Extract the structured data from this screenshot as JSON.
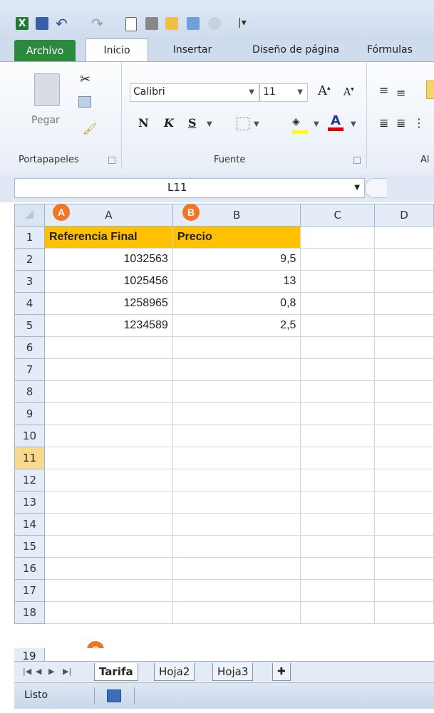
{
  "colors": {
    "accent": "#2c8a3c",
    "header_fill": "#ffc000",
    "badge": "#f07623",
    "active_row": "#f9d98c"
  },
  "qat": {
    "icons": [
      "excel-logo-icon",
      "save-icon",
      "undo-icon",
      "redo-icon",
      "new-file-icon",
      "print-preview-icon",
      "open-folder-icon",
      "window-icon",
      "circle-icon",
      "customize-icon"
    ]
  },
  "tabs": {
    "archivo": "Archivo",
    "inicio": "Inicio",
    "insertar": "Insertar",
    "diseno": "Diseño de página",
    "formulas": "Fórmulas"
  },
  "ribbon": {
    "clipboard": {
      "paste": "Pegar",
      "group": "Portapapeles"
    },
    "font": {
      "name": "Calibri",
      "size": "11",
      "bold": "N",
      "italic": "K",
      "underline": "S",
      "group": "Fuente"
    },
    "align": {
      "group": "Al"
    }
  },
  "name_box": "L11",
  "columns": [
    "A",
    "B",
    "C",
    "D"
  ],
  "rows": [
    {
      "n": "1",
      "a": "Referencia Final",
      "b": "Precio"
    },
    {
      "n": "2",
      "a": "1032563",
      "b": "9,5"
    },
    {
      "n": "3",
      "a": "1025456",
      "b": "13"
    },
    {
      "n": "4",
      "a": "1258965",
      "b": "0,8"
    },
    {
      "n": "5",
      "a": "1234589",
      "b": "2,5"
    },
    {
      "n": "6",
      "a": "",
      "b": ""
    },
    {
      "n": "7",
      "a": "",
      "b": ""
    },
    {
      "n": "8",
      "a": "",
      "b": ""
    },
    {
      "n": "9",
      "a": "",
      "b": ""
    },
    {
      "n": "10",
      "a": "",
      "b": ""
    },
    {
      "n": "11",
      "a": "",
      "b": ""
    },
    {
      "n": "12",
      "a": "",
      "b": ""
    },
    {
      "n": "13",
      "a": "",
      "b": ""
    },
    {
      "n": "14",
      "a": "",
      "b": ""
    },
    {
      "n": "15",
      "a": "",
      "b": ""
    },
    {
      "n": "16",
      "a": "",
      "b": ""
    },
    {
      "n": "17",
      "a": "",
      "b": ""
    },
    {
      "n": "18",
      "a": "",
      "b": ""
    }
  ],
  "active_row": "11",
  "badges": {
    "a": "A",
    "b": "B",
    "c": "C"
  },
  "sheet_tabs": [
    "Tarifa",
    "Hoja2",
    "Hoja3"
  ],
  "status": "Listo"
}
